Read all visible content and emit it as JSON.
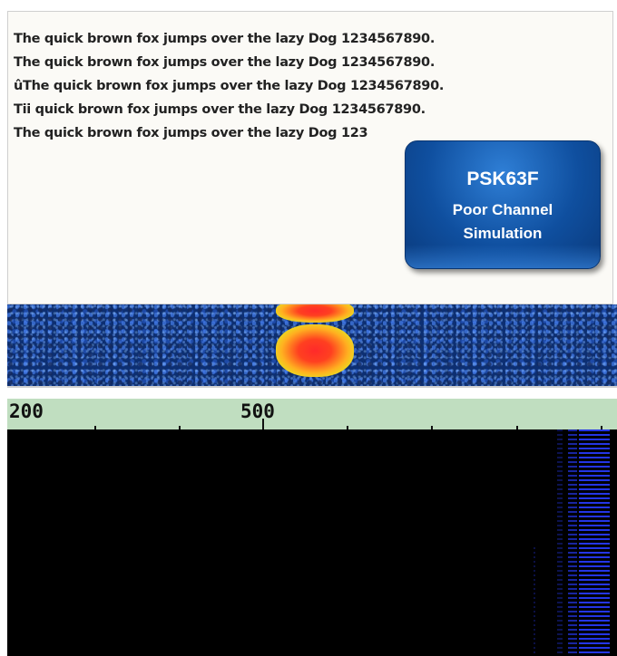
{
  "rx_text": {
    "lines": [
      "The quick brown fox jumps over the lazy Dog 1234567890.",
      "The quick brown fox jumps over the lazy Dog 1234567890.",
      "ûThe quick brown fox jumps over the lazy Dog 1234567890.",
      "Tii quick brown fox jumps over the lazy Dog 1234567890.",
      "The quick brown fox jumps over the lazy Dog 123"
    ]
  },
  "badge": {
    "title": "PSK63F",
    "subtitle_line1": "Poor Channel",
    "subtitle_line2": "Simulation"
  },
  "frequency_scale": {
    "labels": [
      "200",
      "500"
    ]
  },
  "colors": {
    "rx_background": "#fbfaf6",
    "badge_blue": "#0f4f9f",
    "scale_green": "#c0dec0",
    "waterfall_background": "#000000",
    "signal_red": "#ff2a2a"
  }
}
